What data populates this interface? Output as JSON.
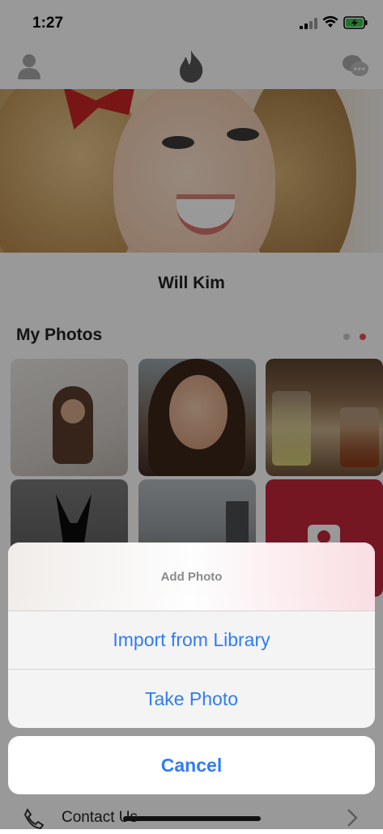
{
  "status_bar": {
    "time": "1:27"
  },
  "profile": {
    "name": "Will Kim"
  },
  "photos_section": {
    "title": "My Photos"
  },
  "contact": {
    "label": "Contact Us"
  },
  "action_sheet": {
    "title": "Add Photo",
    "options": [
      "Import from Library",
      "Take Photo"
    ],
    "cancel": "Cancel"
  },
  "colors": {
    "accent": "#2f7cf6",
    "brand": "#e8505b",
    "add_photo_tile": "#c3253b"
  },
  "icons": [
    "profile-icon",
    "flame-icon",
    "chat-icon",
    "camera-icon",
    "phone-icon",
    "chevron-right-icon"
  ]
}
